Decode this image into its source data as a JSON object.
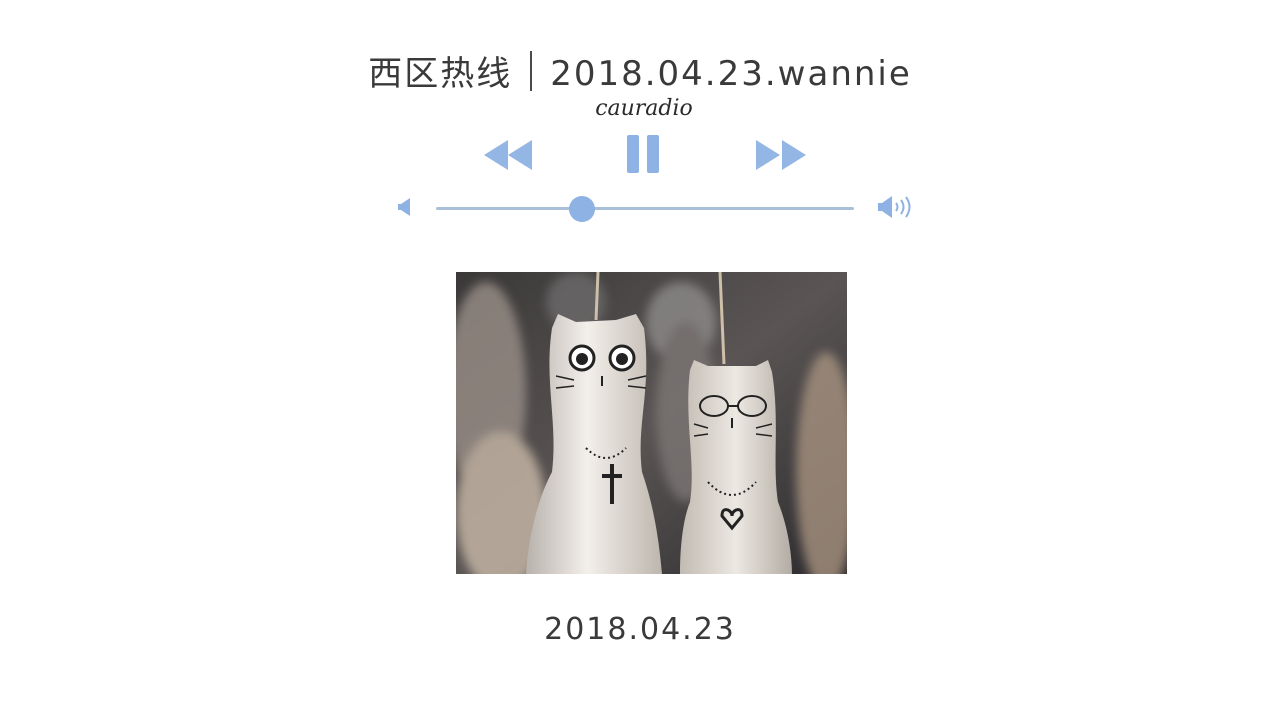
{
  "header": {
    "station": "西区热线",
    "episode": "2018.04.23.wannie",
    "brand": "cauradio"
  },
  "player": {
    "controls": {
      "rewind_icon": "rewind-icon",
      "pause_icon": "pause-icon",
      "fast_forward_icon": "fast-forward-icon"
    },
    "volume": {
      "low_icon": "volume-low-icon",
      "high_icon": "volume-high-icon",
      "level": 0.35
    },
    "accent_color": "#8eb2e4",
    "track_color": "#a9bfd8"
  },
  "cover": {
    "image": "ceramic-cat-wind-chimes"
  },
  "footer": {
    "date": "2018.04.23"
  }
}
